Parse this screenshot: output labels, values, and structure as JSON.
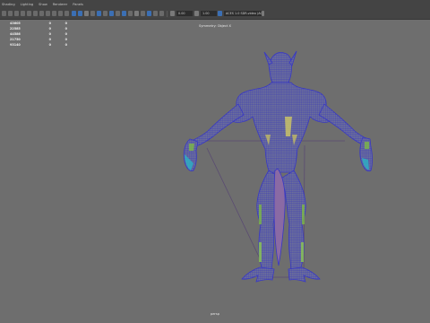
{
  "menubar": {
    "items": [
      "Shading",
      "Lighting",
      "Show",
      "Renderer",
      "Panels"
    ]
  },
  "toolbar": {
    "field_1": "0.00",
    "field_2": "1.00",
    "colorspace": "ACES 1.0 SDR-video (ACES)"
  },
  "hud": {
    "rows": [
      {
        "c1": "43605",
        "c2": "0",
        "c3": "0"
      },
      {
        "c1": "22585",
        "c2": "0",
        "c3": "0"
      },
      {
        "c1": "44586",
        "c2": "0",
        "c3": "0"
      },
      {
        "c1": "21750",
        "c2": "0",
        "c3": "0"
      },
      {
        "c1": "93140",
        "c2": "0",
        "c3": "0"
      }
    ]
  },
  "viewport": {
    "symmetry_label": "Symmetry: Object X",
    "camera_label": "persp"
  },
  "colors": {
    "viewport_bg": "#6e6e6e",
    "panel_bg": "#444444",
    "wire_blue": "#3d3dc8",
    "wire_green": "#7fbf3f"
  }
}
